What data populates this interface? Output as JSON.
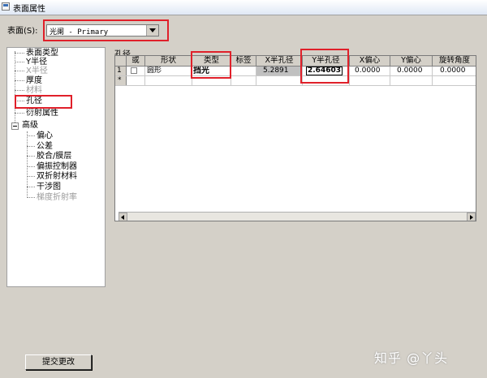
{
  "window": {
    "title": "表面属性"
  },
  "surface": {
    "label": "表面(S):",
    "selected": "光阑 - Primary"
  },
  "tree": {
    "items": [
      {
        "label": "表面类型",
        "gray": false
      },
      {
        "label": "Y半径",
        "gray": false
      },
      {
        "label": "X半径",
        "gray": true
      },
      {
        "label": "厚度",
        "gray": false
      },
      {
        "label": "材料",
        "gray": true
      },
      {
        "label": "孔径",
        "gray": false
      },
      {
        "label": "衍射属性",
        "gray": false
      },
      {
        "label": "高级",
        "gray": false
      },
      {
        "label": "偏心",
        "gray": false
      },
      {
        "label": "公差",
        "gray": false
      },
      {
        "label": "胶合/膜层",
        "gray": false
      },
      {
        "label": "偏振控制器",
        "gray": false
      },
      {
        "label": "双折射材料",
        "gray": false
      },
      {
        "label": "干涉图",
        "gray": false
      },
      {
        "label": "梯度折射率",
        "gray": true
      }
    ]
  },
  "aperture": {
    "section_label": "孔径",
    "columns": [
      "",
      "或",
      "形状",
      "类型",
      "标签",
      "X半孔径",
      "Y半孔径",
      "X偏心",
      "Y偏心",
      "旋转角度"
    ],
    "row1": {
      "index": "1",
      "shape": "圆形",
      "type": "挡光",
      "label": "",
      "x_half": "5.2891",
      "y_half": "2.64603",
      "x_dec": "0.0000",
      "y_dec": "0.0000",
      "rotation": "0.0000"
    },
    "row2": {
      "index": "*"
    }
  },
  "actions": {
    "submit": "提交更改"
  },
  "watermark": "知乎 @丫头"
}
